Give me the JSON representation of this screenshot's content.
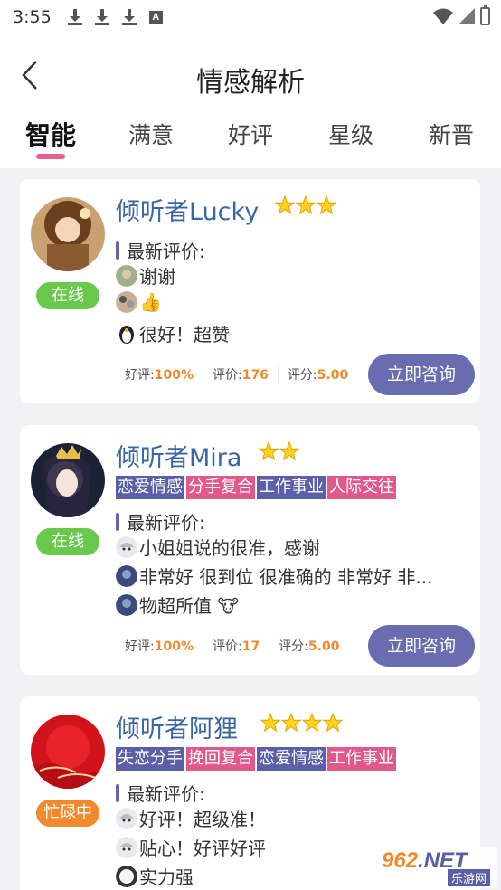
{
  "statusbar": {
    "time": "3:55"
  },
  "header": {
    "title": "情感解析"
  },
  "tabs": [
    {
      "label": "智能"
    },
    {
      "label": "满意"
    },
    {
      "label": "好评"
    },
    {
      "label": "星级"
    },
    {
      "label": "新晋"
    }
  ],
  "cards": [
    {
      "name": "倾听者Lucky",
      "stars": 3,
      "status": "在线",
      "latest_label": "最新评价:",
      "reviews": [
        "谢谢",
        "👍",
        "很好！超赞"
      ],
      "stats": {
        "good_label": "好评:",
        "good": "100%",
        "count_label": "评价:",
        "count": "176",
        "score_label": "评分:",
        "score": "5.00"
      },
      "consult": "立即咨询"
    },
    {
      "name": "倾听者Mira",
      "stars": 2,
      "status": "在线",
      "tags": [
        "恋爱情感",
        "分手复合",
        "工作事业",
        "人际交往"
      ],
      "latest_label": "最新评价:",
      "reviews": [
        "小姐姐说的很准，感谢",
        "非常好 很到位 很准确的 非常好 非...",
        "物超所值 🐮"
      ],
      "stats": {
        "good_label": "好评:",
        "good": "100%",
        "count_label": "评价:",
        "count": "17",
        "score_label": "评分:",
        "score": "5.00"
      },
      "consult": "立即咨询"
    },
    {
      "name": "倾听者阿狸",
      "stars": 4,
      "status": "忙碌中",
      "tags": [
        "失恋分手",
        "挽回复合",
        "恋爱情感",
        "工作事业"
      ],
      "latest_label": "最新评价:",
      "reviews": [
        "好评！超级准！",
        "贴心！好评好评",
        "实力强"
      ]
    }
  ],
  "watermark": {
    "main": "962",
    "net": ".NET",
    "sub": "乐游网"
  },
  "colors": {
    "accent": "#6a6cb0",
    "name_blue": "#3966a6",
    "pink": "#e0598a",
    "online": "#68c94c",
    "busy": "#f08a2c"
  }
}
